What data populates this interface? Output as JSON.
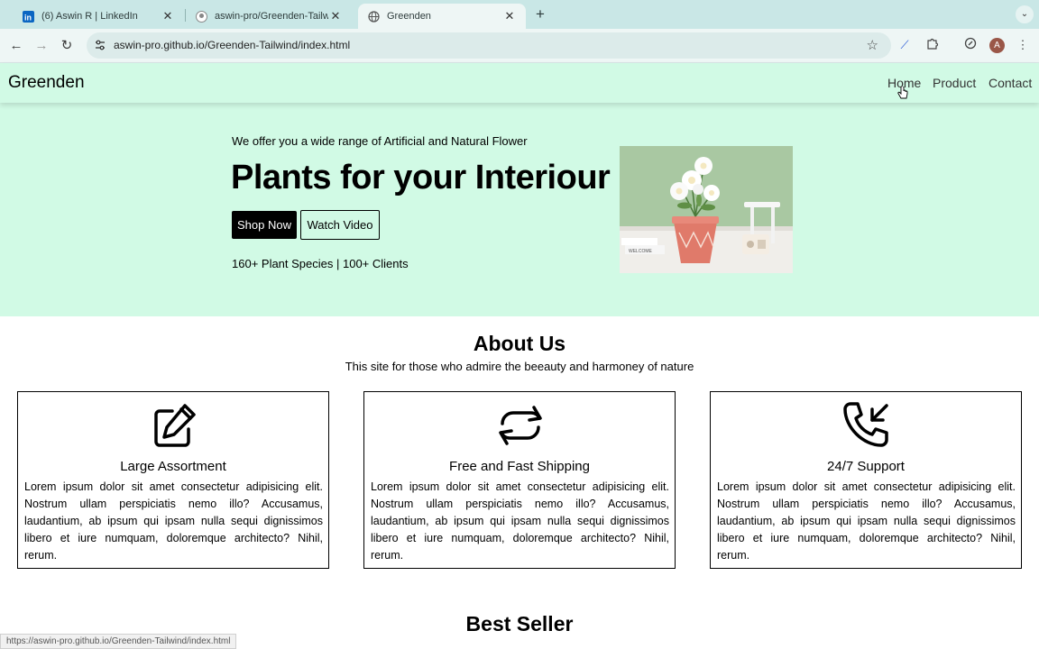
{
  "browser": {
    "tabs": [
      {
        "title": "(6) Aswin R | LinkedIn",
        "icon": "linkedin-icon"
      },
      {
        "title": "aswin-pro/Greenden-Tailwind",
        "icon": "github-icon"
      },
      {
        "title": "Greenden",
        "icon": "globe-icon",
        "active": true
      }
    ],
    "url": "aswin-pro.github.io/Greenden-Tailwind/index.html",
    "profile_initial": "A",
    "status_url": "https://aswin-pro.github.io/Greenden-Tailwind/index.html"
  },
  "nav": {
    "brand": "Greenden",
    "links": [
      "Home",
      "Product",
      "Contact"
    ]
  },
  "hero": {
    "tagline": "We offer you a wide range of Artificial and Natural Flower",
    "headline": "Plants for your Interiour",
    "primary_button": "Shop Now",
    "secondary_button": "Watch Video",
    "stats": "160+ Plant Species | 100+ Clients",
    "image_label": "WELCOME"
  },
  "about": {
    "title": "About Us",
    "subtitle": "This site for those who admire the beeauty and harmoney of nature",
    "cards": [
      {
        "icon": "pencil-square-icon",
        "title": "Large Assortment",
        "text": "Lorem ipsum dolor sit amet consectetur adipisicing elit. Nostrum ullam perspiciatis nemo illo? Accusamus, laudantium, ab ipsum qui ipsam nulla sequi dignissimos libero et iure numquam, doloremque architecto? Nihil, rerum."
      },
      {
        "icon": "refresh-arrows-icon",
        "title": "Free and Fast Shipping",
        "text": "Lorem ipsum dolor sit amet consectetur adipisicing elit. Nostrum ullam perspiciatis nemo illo? Accusamus, laudantium, ab ipsum qui ipsam nulla sequi dignissimos libero et iure numquam, doloremque architecto? Nihil, rerum."
      },
      {
        "icon": "phone-incoming-icon",
        "title": "24/7 Support",
        "text": "Lorem ipsum dolor sit amet consectetur adipisicing elit. Nostrum ullam perspiciatis nemo illo? Accusamus, laudantium, ab ipsum qui ipsam nulla sequi dignissimos libero et iure numquam, doloremque architecto? Nihil, rerum."
      }
    ]
  },
  "best_seller": {
    "title": "Best Seller"
  },
  "colors": {
    "accent_bg": "#d1fae5",
    "button_dark": "#000000",
    "tabstrip": "#c9e7e6"
  }
}
